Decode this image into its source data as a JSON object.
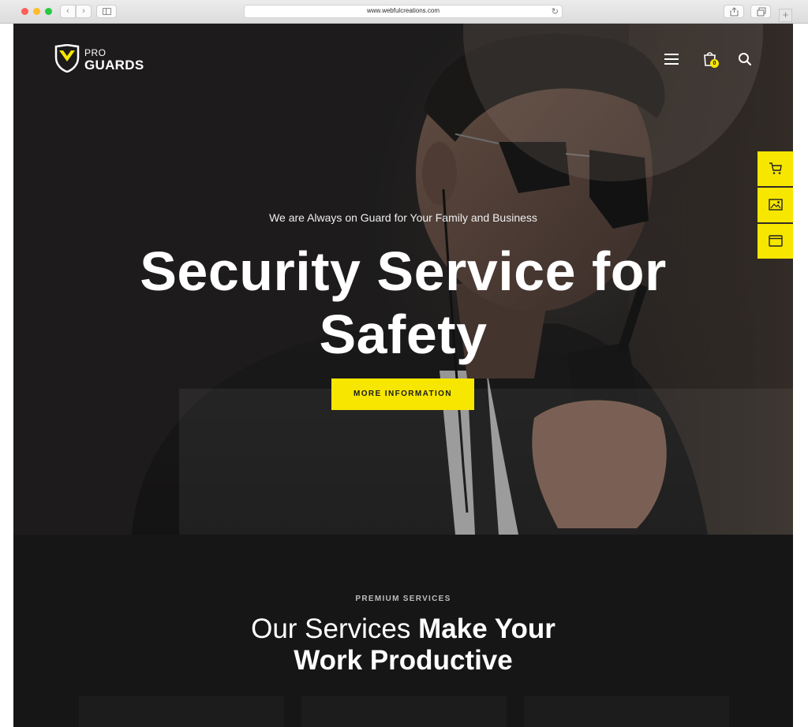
{
  "browser": {
    "url": "www.webfulcreations.com",
    "back_icon": "chevron-left-icon",
    "forward_icon": "chevron-right-icon",
    "reload_icon": "reload-icon",
    "new_tab_label": "+"
  },
  "header": {
    "logo_top": "PRO",
    "logo_bottom": "GUARDS",
    "cart_count": "0",
    "icons": [
      "menu-icon",
      "cart-icon",
      "search-icon"
    ]
  },
  "hero": {
    "tagline": "We are Always on Guard for Your Family and Business",
    "title": "Security Service for Safety",
    "cta_label": "MORE INFORMATION"
  },
  "side_tools": [
    "cart-icon",
    "image-icon",
    "browser-window-icon"
  ],
  "services": {
    "eyebrow": "PREMIUM SERVICES",
    "title_light": "Our Services ",
    "title_bold_1": "Make Your",
    "title_bold_2": "Work Productive"
  },
  "colors": {
    "accent": "#f6e600",
    "background": "#171617",
    "text": "#ffffff"
  }
}
